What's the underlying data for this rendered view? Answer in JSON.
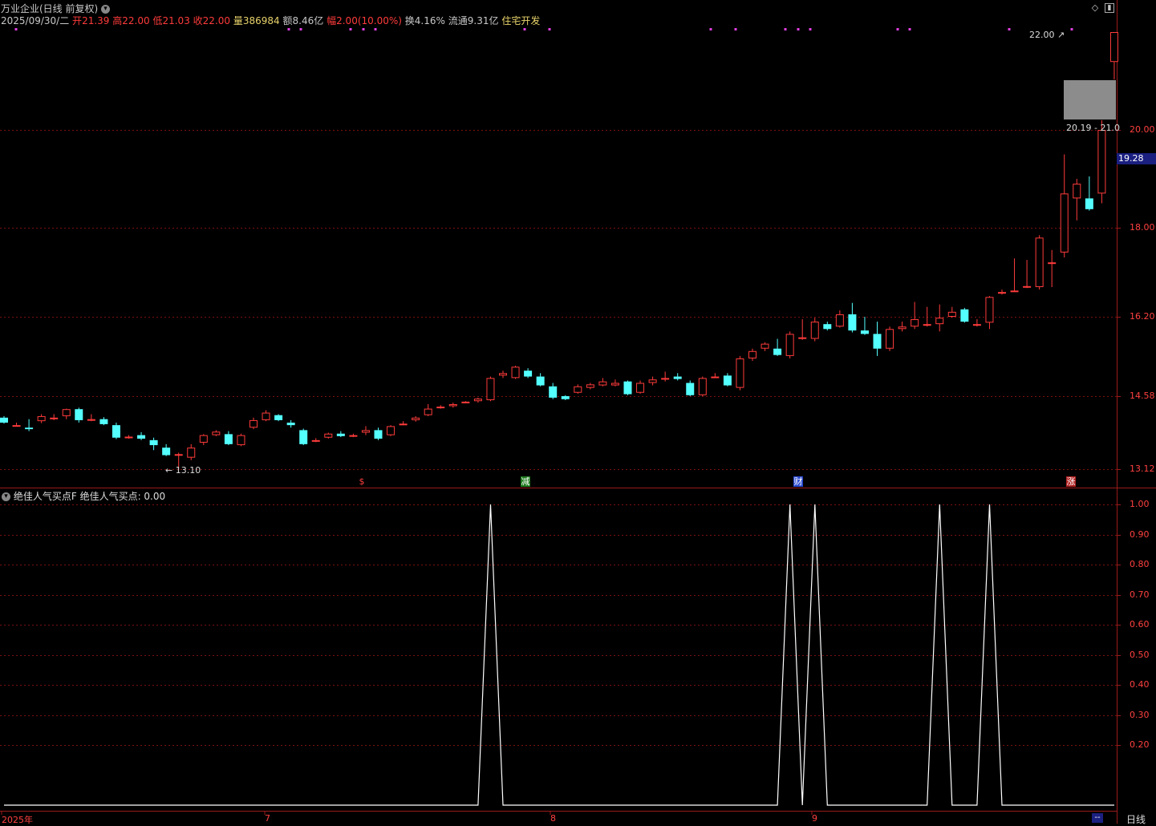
{
  "header": {
    "title": "万业企业(日线 前复权)",
    "date": "2025/09/30/二",
    "open_label": "开",
    "open": "21.39",
    "high_label": "高",
    "high": "22.00",
    "low_label": "低",
    "low": "21.03",
    "close_label": "收",
    "close": "22.00",
    "vol_label": "量",
    "vol": "386984",
    "amount_label": "额",
    "amount": "8.46亿",
    "chg_label": "幅",
    "chg": "2.00(10.00%)",
    "turnover_label": "换",
    "turnover": "4.16%",
    "float_label": "流通",
    "float": "9.31亿",
    "sector": "住宅开发"
  },
  "price_pane": {
    "y_ticks": [
      "20.00",
      "18.00",
      "16.20",
      "14.58",
      "13.12"
    ],
    "current_price": "19.28",
    "high_annotation": "22.00",
    "low_annotation": "13.10",
    "range_box_label": "20.19 - 21.0",
    "event_marks": [
      {
        "text": "$",
        "color": "#ff4040"
      },
      {
        "text": "减",
        "color": "#3fbf3f"
      },
      {
        "text": "财",
        "color": "#4f7fff"
      },
      {
        "text": "涨",
        "color": "#ff4040"
      }
    ]
  },
  "indicator_pane": {
    "title": "绝佳人气买点F",
    "value_label": "绝佳人气买点: 0.00",
    "y_ticks": [
      "1.00",
      "0.90",
      "0.80",
      "0.70",
      "0.60",
      "0.50",
      "0.40",
      "0.30",
      "0.20"
    ]
  },
  "x_axis": {
    "labels": [
      "2025年",
      "7",
      "8",
      "9"
    ]
  },
  "footer": {
    "period_label": "日线",
    "dash": "--"
  },
  "colors": {
    "up": "#ff3b3b",
    "down": "#54ffff",
    "grid": "#7a1010",
    "signal_line": "#ffffff",
    "dot_marker": "#e040e0"
  },
  "chart_data": [
    {
      "type": "candlestick",
      "title": "万业企业(日线 前复权)",
      "ylim": [
        13.0,
        22.3
      ],
      "bars_ohlc": [
        [
          14.15,
          14.18,
          14.05,
          14.03
        ],
        [
          14.0,
          14.05,
          14.0,
          13.97
        ],
        [
          13.95,
          14.12,
          13.92,
          13.88
        ],
        [
          14.08,
          14.22,
          14.18,
          14.04
        ],
        [
          14.15,
          14.22,
          14.15,
          14.1
        ],
        [
          14.18,
          14.33,
          14.32,
          14.12
        ],
        [
          14.32,
          14.35,
          14.1,
          14.05
        ],
        [
          14.1,
          14.22,
          14.12,
          14.08
        ],
        [
          14.12,
          14.16,
          14.02,
          14.0
        ],
        [
          14.0,
          14.05,
          13.75,
          13.72
        ],
        [
          13.75,
          13.8,
          13.77,
          13.73
        ],
        [
          13.8,
          13.86,
          13.73,
          13.7
        ],
        [
          13.7,
          13.75,
          13.6,
          13.5
        ],
        [
          13.55,
          13.62,
          13.4,
          13.38
        ],
        [
          13.4,
          13.45,
          13.42,
          13.1
        ],
        [
          13.35,
          13.62,
          13.55,
          13.3
        ],
        [
          13.65,
          13.82,
          13.8,
          13.6
        ],
        [
          13.8,
          13.9,
          13.87,
          13.78
        ],
        [
          13.82,
          13.88,
          13.62,
          13.6
        ],
        [
          13.6,
          13.83,
          13.8,
          13.58
        ],
        [
          13.95,
          14.15,
          14.1,
          13.92
        ],
        [
          14.1,
          14.3,
          14.25,
          14.08
        ],
        [
          14.2,
          14.22,
          14.1,
          14.08
        ],
        [
          14.05,
          14.1,
          14.0,
          13.95
        ],
        [
          13.9,
          13.93,
          13.62,
          13.6
        ],
        [
          13.68,
          13.74,
          13.7,
          13.66
        ],
        [
          13.75,
          13.85,
          13.83,
          13.73
        ],
        [
          13.83,
          13.88,
          13.78,
          13.76
        ],
        [
          13.78,
          13.83,
          13.8,
          13.76
        ],
        [
          13.85,
          13.98,
          13.9,
          13.8
        ],
        [
          13.9,
          13.95,
          13.73,
          13.7
        ],
        [
          13.8,
          14.0,
          13.98,
          13.78
        ],
        [
          14.0,
          14.08,
          14.03,
          14.0
        ],
        [
          14.1,
          14.18,
          14.15,
          14.07
        ],
        [
          14.2,
          14.42,
          14.33,
          14.18
        ],
        [
          14.35,
          14.4,
          14.37,
          14.33
        ],
        [
          14.38,
          14.45,
          14.42,
          14.35
        ],
        [
          14.45,
          14.48,
          14.47,
          14.44
        ],
        [
          14.48,
          14.55,
          14.53,
          14.45
        ],
        [
          14.5,
          14.98,
          14.95,
          14.48
        ],
        [
          15.0,
          15.1,
          15.05,
          14.95
        ],
        [
          14.95,
          15.2,
          15.18,
          14.93
        ],
        [
          15.1,
          15.15,
          14.98,
          14.95
        ],
        [
          14.98,
          15.05,
          14.8,
          14.78
        ],
        [
          14.78,
          14.85,
          14.55,
          14.52
        ],
        [
          14.58,
          14.6,
          14.52,
          14.5
        ],
        [
          14.65,
          14.82,
          14.78,
          14.63
        ],
        [
          14.75,
          14.85,
          14.82,
          14.72
        ],
        [
          14.8,
          14.95,
          14.88,
          14.78
        ],
        [
          14.8,
          14.92,
          14.85,
          14.78
        ],
        [
          14.88,
          14.9,
          14.62,
          14.6
        ],
        [
          14.65,
          14.9,
          14.85,
          14.63
        ],
        [
          14.85,
          14.98,
          14.92,
          14.8
        ],
        [
          14.92,
          15.08,
          14.95,
          14.88
        ],
        [
          14.98,
          15.05,
          14.93,
          14.9
        ],
        [
          14.85,
          14.9,
          14.6,
          14.58
        ],
        [
          14.6,
          14.98,
          14.95,
          14.58
        ],
        [
          14.98,
          15.05,
          14.98,
          14.95
        ],
        [
          15.0,
          15.05,
          14.8,
          14.78
        ],
        [
          14.75,
          15.4,
          15.35,
          14.7
        ],
        [
          15.35,
          15.55,
          15.5,
          15.3
        ],
        [
          15.55,
          15.68,
          15.65,
          15.5
        ],
        [
          15.55,
          15.75,
          15.42,
          15.4
        ],
        [
          15.4,
          15.9,
          15.85,
          15.35
        ],
        [
          15.75,
          16.15,
          15.78,
          15.73
        ],
        [
          15.75,
          16.18,
          16.1,
          15.7
        ],
        [
          16.05,
          16.1,
          15.95,
          15.92
        ],
        [
          16.0,
          16.33,
          16.25,
          15.98
        ],
        [
          16.25,
          16.48,
          15.92,
          15.88
        ],
        [
          15.92,
          16.2,
          15.85,
          15.83
        ],
        [
          15.85,
          16.1,
          15.55,
          15.4
        ],
        [
          15.55,
          16.0,
          15.95,
          15.5
        ],
        [
          15.95,
          16.1,
          16.0,
          15.9
        ],
        [
          16.0,
          16.5,
          16.15,
          15.95
        ],
        [
          16.05,
          16.4,
          16.05,
          16.0
        ],
        [
          16.05,
          16.45,
          16.18,
          15.9
        ],
        [
          16.2,
          16.4,
          16.3,
          16.18
        ],
        [
          16.35,
          16.38,
          16.1,
          16.08
        ],
        [
          16.05,
          16.15,
          16.05,
          16.0
        ],
        [
          16.08,
          16.62,
          16.6,
          15.95
        ],
        [
          16.7,
          16.75,
          16.7,
          16.65
        ],
        [
          16.72,
          17.38,
          16.73,
          16.7
        ],
        [
          16.8,
          17.35,
          16.82,
          16.78
        ],
        [
          16.8,
          17.85,
          17.8,
          16.75
        ],
        [
          17.3,
          17.55,
          17.3,
          16.8
        ],
        [
          17.5,
          19.5,
          18.7,
          17.4
        ],
        [
          18.6,
          19.0,
          18.9,
          18.15
        ],
        [
          18.6,
          19.05,
          18.38,
          18.35
        ],
        [
          18.7,
          20.2,
          20.0,
          18.5
        ],
        [
          21.39,
          22.0,
          22.0,
          21.03
        ]
      ],
      "event_markers": [
        "$",
        "减",
        "财",
        "涨"
      ]
    },
    {
      "type": "line",
      "title": "绝佳人气买点F",
      "series": [
        {
          "name": "绝佳人气买点",
          "values": [
            0,
            0,
            0,
            0,
            0,
            0,
            0,
            0,
            0,
            0,
            0,
            0,
            0,
            0,
            0,
            0,
            0,
            0,
            0,
            0,
            0,
            0,
            0,
            0,
            0,
            0,
            0,
            0,
            0,
            0,
            0,
            0,
            0,
            0,
            0,
            0,
            0,
            0,
            0,
            1,
            0,
            0,
            0,
            0,
            0,
            0,
            0,
            0,
            0,
            0,
            0,
            0,
            0,
            0,
            0,
            0,
            0,
            0,
            0,
            0,
            0,
            0,
            0,
            1,
            0,
            1,
            0,
            0,
            0,
            0,
            0,
            0,
            0,
            0,
            0,
            1,
            0,
            0,
            0,
            1,
            0,
            0,
            0,
            0,
            0,
            0,
            0,
            0,
            0,
            0
          ]
        }
      ],
      "ylim": [
        0,
        1.0
      ],
      "current_value": 0.0
    }
  ]
}
